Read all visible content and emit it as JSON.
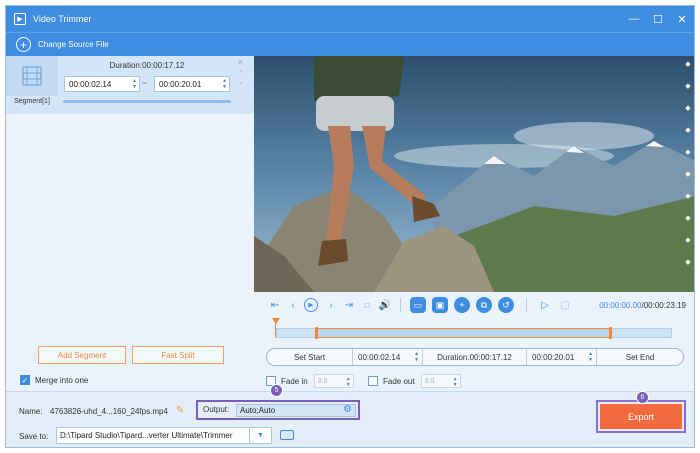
{
  "window": {
    "title": "Video Trimmer",
    "controls": [
      "minimize-icon",
      "maximize-icon",
      "close-icon"
    ]
  },
  "toolbar": {
    "change_source_label": "Change Source File"
  },
  "segment": {
    "label": "Segment[1]",
    "duration": "Duration:00:00:17.12",
    "start": "00:00:02.14",
    "end": "00:00:20.01",
    "separator": "~"
  },
  "left_buttons": {
    "add_segment": "Add Segment",
    "fast_split": "Fast Split"
  },
  "merge": {
    "label": "Merge into one",
    "checked": true
  },
  "playback": {
    "current": "00:00:00.00",
    "separator": "/",
    "total": "00:00:23.19"
  },
  "setbar": {
    "set_start": "Set Start",
    "start": "00:00:02.14",
    "duration": "Duration:00:00:17.12",
    "end": "00:00:20.01",
    "set_end": "Set End"
  },
  "fade": {
    "fade_in_label": "Fade in",
    "fade_in_value": "3.0",
    "fade_out_label": "Fade out",
    "fade_out_value": "3.0"
  },
  "bottom": {
    "name_label": "Name:",
    "name_value": "4763826-uhd_4...160_24fps.mp4",
    "output_label": "Output:",
    "output_value": "Auto;Auto",
    "saveto_label": "Save to:",
    "saveto_value": "D:\\Tipard Studio\\Tipard...verter Ultimate\\Trimmer",
    "export_label": "Export"
  },
  "badges": {
    "output_step": "5",
    "export_step": "6"
  },
  "colors": {
    "accent": "#3f8de0",
    "export": "#f26a3d",
    "highlight": "#7a5fb8",
    "handle": "#f08a3a"
  }
}
